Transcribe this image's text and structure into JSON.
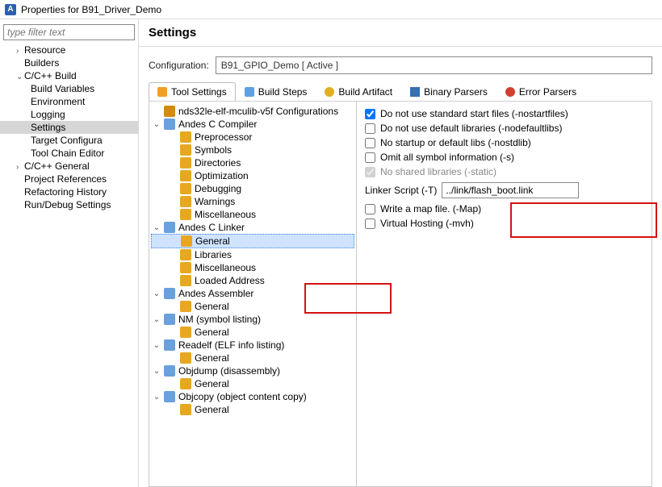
{
  "window": {
    "title": "Properties for B91_Driver_Demo"
  },
  "filter": {
    "placeholder": "type filter text"
  },
  "nav": {
    "resource": "Resource",
    "builders": "Builders",
    "ccbuild": "C/C++ Build",
    "buildvars": "Build Variables",
    "environment": "Environment",
    "logging": "Logging",
    "settings": "Settings",
    "targetcfg": "Target Configura",
    "toolchain": "Tool Chain Editor",
    "ccgeneral": "C/C++ General",
    "projrefs": "Project References",
    "refactor": "Refactoring History",
    "rundebug": "Run/Debug Settings"
  },
  "settings_title": "Settings",
  "config": {
    "label": "Configuration:",
    "value": "B91_GPIO_Demo  [ Active ]"
  },
  "tabs": {
    "tool": "Tool Settings",
    "steps": "Build Steps",
    "artifact": "Build Artifact",
    "binary": "Binary Parsers",
    "errors": "Error Parsers"
  },
  "tree": {
    "cfg": "nds32le-elf-mculib-v5f Configurations",
    "compiler": "Andes C Compiler",
    "preproc": "Preprocessor",
    "symbols": "Symbols",
    "dirs": "Directories",
    "opt": "Optimization",
    "debug": "Debugging",
    "warn": "Warnings",
    "misc": "Miscellaneous",
    "linker": "Andes C Linker",
    "general": "General",
    "libraries": "Libraries",
    "misc2": "Miscellaneous",
    "loaded": "Loaded Address",
    "asm": "Andes Assembler",
    "asm_gen": "General",
    "nm": "NM (symbol listing)",
    "nm_gen": "General",
    "readelf": "Readelf (ELF info listing)",
    "readelf_gen": "General",
    "objdump": "Objdump (disassembly)",
    "objdump_gen": "General",
    "objcopy": "Objcopy (object content copy)",
    "objcopy_gen": "General"
  },
  "opts": {
    "nostart": "Do not use standard start files (-nostartfiles)",
    "nodef": "Do not use default libraries (-nodefaultlibs)",
    "nostd": "No startup or default libs (-nostdlib)",
    "omit": "Omit all symbol information (-s)",
    "noshared": "No shared libraries (-static)",
    "lscript_label": "Linker Script (-T)",
    "lscript_value": "../link/flash_boot.link",
    "map": "Write a map file. (-Map)",
    "mvh": "Virtual Hosting (-mvh)"
  }
}
